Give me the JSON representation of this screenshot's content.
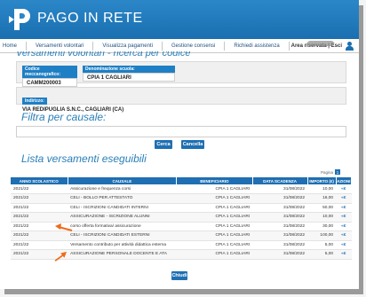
{
  "header": {
    "app_title": "PAGO IN RETE"
  },
  "nav": {
    "items": [
      "Home",
      "Versamenti volontari",
      "Visualizza pagamenti",
      "Gestione consensi",
      "Richiedi assistenza"
    ],
    "reserved_area": "Area riservata | Esci"
  },
  "form": {
    "heading": "Versamenti volontari - ricerca per codice",
    "codice_label": "Codice meccanografico:",
    "codice_value": "CAMM200003",
    "denominazione_label": "Denominazione scuola:",
    "denominazione_value": "CPIA 1 CAGLIARI",
    "indirizzo_label": "Indirizzo:",
    "indirizzo_value": "VIA REDIPUGLIA S.N.C., CAGLIARI (CA)"
  },
  "filter": {
    "heading": "Filtra per causale:",
    "search_label": "Cerca",
    "clear_label": "Cancella"
  },
  "list": {
    "heading": "Lista versamenti eseguibili",
    "pager_label": "Pagina",
    "pager_value": "1",
    "columns": [
      "ANNO SCOLASTICO",
      "CAUSALE",
      "BENEFICIARIO",
      "DATA SCADENZA",
      "IMPORTO (€)",
      "AZIONI"
    ],
    "rows": [
      [
        "2021/22",
        "Assicurazione e frequenza corsi",
        "CPIA 1 CAGLIARI",
        "31/08/2022",
        "10,00",
        "«€"
      ],
      [
        "2021/22",
        "CELI - BOLLO PER ATTESTATO",
        "CPIA 1 CAGLIARI",
        "31/08/2022",
        "16,00",
        "«€"
      ],
      [
        "2021/22",
        "CELI - ISCRIZIONI CANDIDATI INTERNI",
        "CPIA 1 CAGLIARI",
        "31/08/2022",
        "50,00",
        "«€"
      ],
      [
        "2021/22",
        "ASSICURAZIONE - ISCRIZIONE ALUNNI",
        "CPIA 1 CAGLIARI",
        "31/08/2022",
        "10,00",
        "«€"
      ],
      [
        "2021/22",
        "corso offerta formativa/ assicurazione",
        "CPIA 1 CAGLIARI",
        "31/08/2022",
        "30,00",
        "«€"
      ],
      [
        "2021/22",
        "CELI - ISCRIZIONI CANDIDATI ESTERNI",
        "CPIA 1 CAGLIARI",
        "31/08/2022",
        "100,00",
        "«€"
      ],
      [
        "2021/22",
        "Versamento contributo per attività didattica esterna",
        "CPIA 1 CAGLIARI",
        "31/08/2022",
        "5,00",
        "«€"
      ],
      [
        "2021/22",
        "ASSICURAZIONE PERSONALE DOCENTE E ATA",
        "CPIA 1 CAGLIARI",
        "31/08/2022",
        "5,00",
        "«€"
      ]
    ],
    "close_label": "Chiudi"
  },
  "colors": {
    "brand": "#1f6fb2",
    "annotation_arrow": "#f06b1a"
  }
}
